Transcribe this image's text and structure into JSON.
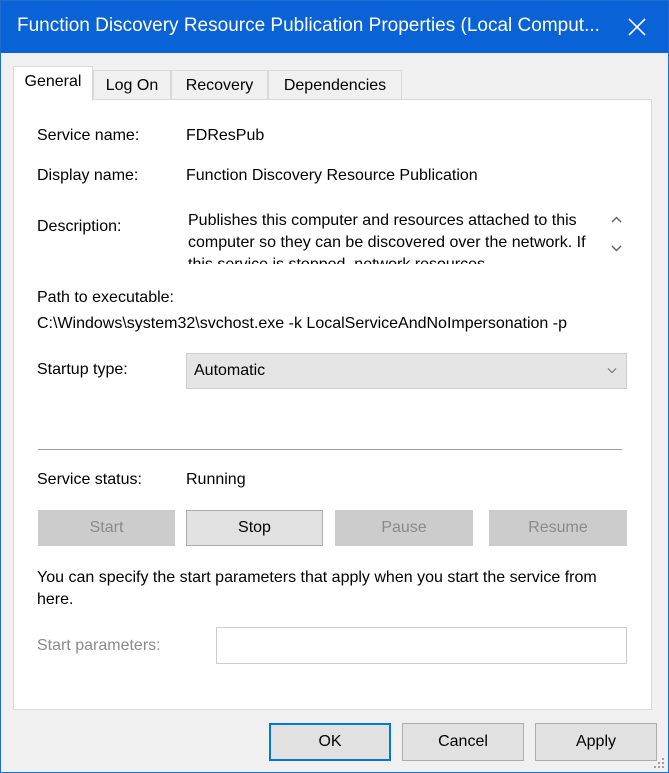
{
  "window": {
    "title": "Function Discovery Resource Publication Properties (Local Comput...",
    "close_icon": "close-icon"
  },
  "tabs": [
    {
      "label": "General",
      "active": true
    },
    {
      "label": "Log On",
      "active": false
    },
    {
      "label": "Recovery",
      "active": false
    },
    {
      "label": "Dependencies",
      "active": false
    }
  ],
  "general": {
    "service_name_label": "Service name:",
    "service_name": "FDResPub",
    "display_name_label": "Display name:",
    "display_name": "Function Discovery Resource Publication",
    "description_label": "Description:",
    "description": "Publishes this computer and resources attached to this computer so they can be discovered over the network.  If this service is stopped, network resources",
    "path_label": "Path to executable:",
    "path": "C:\\Windows\\system32\\svchost.exe -k LocalServiceAndNoImpersonation -p",
    "startup_type_label": "Startup type:",
    "startup_type": "Automatic",
    "service_status_label": "Service status:",
    "service_status": "Running",
    "buttons": {
      "start": "Start",
      "stop": "Stop",
      "pause": "Pause",
      "resume": "Resume"
    },
    "start_params_info": "You can specify the start parameters that apply when you start the service from here.",
    "start_params_label": "Start parameters:",
    "start_params_value": ""
  },
  "dialog_buttons": {
    "ok": "OK",
    "cancel": "Cancel",
    "apply": "Apply"
  },
  "colors": {
    "titlebar": "#0a63d6",
    "focus_border": "#0078d7",
    "disabled_text": "#8a8a8a"
  }
}
